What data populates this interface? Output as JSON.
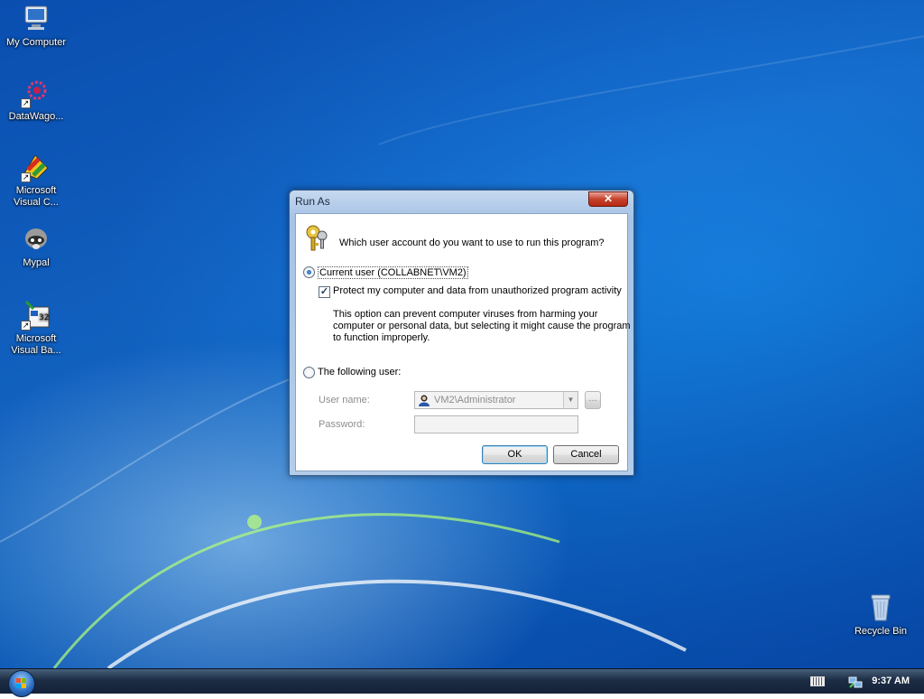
{
  "desktop": {
    "icons": [
      {
        "label": "My Computer"
      },
      {
        "label": "DataWago..."
      },
      {
        "label_line1": "Microsoft",
        "label_line2": "Visual C..."
      },
      {
        "label": "Mypal"
      },
      {
        "label_line1": "Microsoft",
        "label_line2": "Visual Ba..."
      },
      {
        "label": "Recycle Bin"
      }
    ]
  },
  "dialog": {
    "title": "Run As",
    "close_label": "✕",
    "question": "Which user account do you want to use to run this program?",
    "current_user_label": "Current user (COLLABNET\\VM2)",
    "protect_label": "Protect my computer and data from unauthorized program activity",
    "protect_checked": true,
    "info_line1": "This option can prevent computer viruses from harming your",
    "info_line2": "computer or personal data, but selecting it might cause the program",
    "info_line3": "to function improperly.",
    "following_user_label": "The following user:",
    "username_label": "User name:",
    "username_value": "VM2\\Administrator",
    "browse_label": "...",
    "password_label": "Password:",
    "password_value": "",
    "ok_label": "OK",
    "cancel_label": "Cancel"
  },
  "taskbar": {
    "clock": "9:37 AM"
  }
}
